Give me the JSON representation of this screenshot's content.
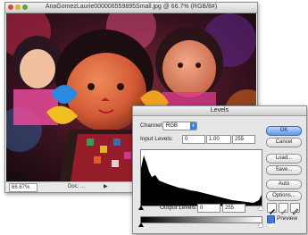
{
  "document": {
    "title": "AnaGomezLaurie000006559895Small.jpg @ 66.7% (RGB/8#)",
    "zoom": "66.67%",
    "info": "Doc: ...",
    "nav_arrow": "▶"
  },
  "levels": {
    "title": "Levels",
    "channel_label": "Channel:",
    "channel_value": "RGB",
    "input_label": "Input Levels:",
    "input_black": "0",
    "input_gamma": "1.00",
    "input_white": "255",
    "output_label": "Output Levels:",
    "output_black": "0",
    "output_white": "255",
    "buttons": {
      "ok": "OK",
      "cancel": "Cancel",
      "load": "Load...",
      "save": "Save...",
      "auto": "Auto",
      "options": "Options..."
    },
    "preview_label": "Preview",
    "preview_checked": true
  },
  "colors": {
    "accent": "#3b7be0"
  }
}
